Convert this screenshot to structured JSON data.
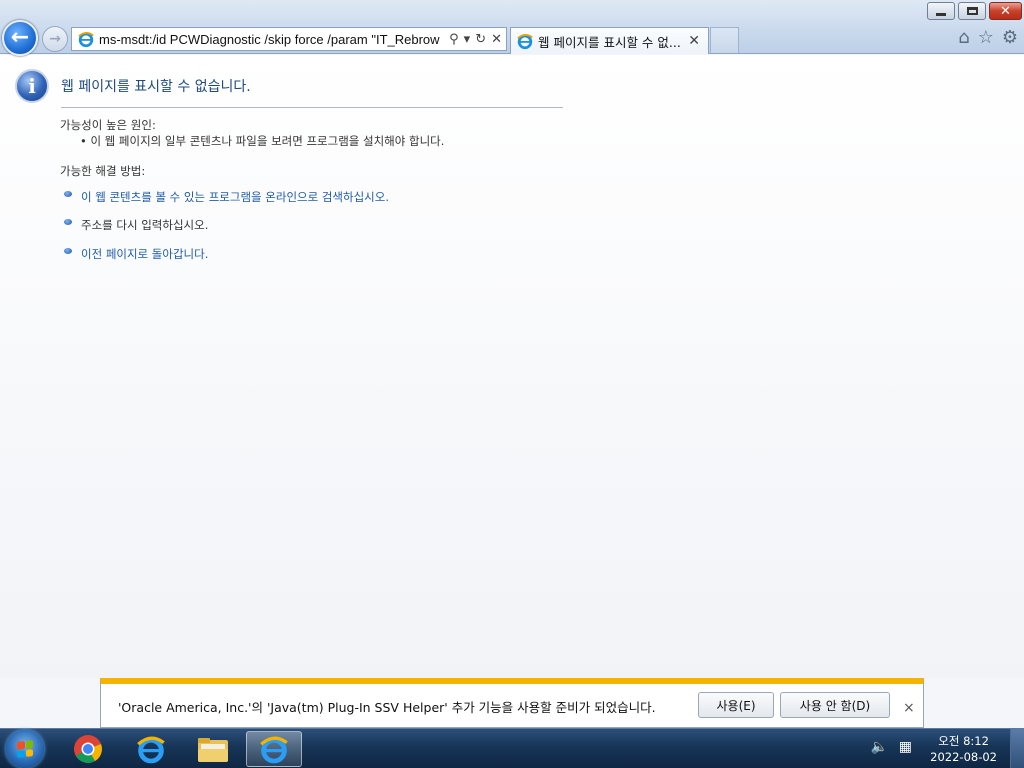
{
  "browser": {
    "address_url": "ms-msdt:/id PCWDiagnostic /skip force /param \"IT_RebrowseFor",
    "tab_title": "웹 페이지를 표시할 수 없...",
    "tab_close": "✕",
    "icons": {
      "back": "←",
      "forward": "→",
      "search": "⚲",
      "dropdown": "▾",
      "refresh": "↻",
      "stop": "✕",
      "home": "⌂",
      "favorites": "☆",
      "tools": "⚙"
    }
  },
  "page": {
    "title": "웹 페이지를 표시할 수 없습니다.",
    "cause_label": "가능성이 높은 원인:",
    "cause_item": "• 이 웹 페이지의 일부 콘텐츠나 파일을 보려면 프로그램을 설치해야 합니다.",
    "solution_label": "가능한 해결 방법:",
    "solutions": [
      "이 웹 콘텐츠를 볼 수 있는 프로그램을 온라인으로 검색하십시오.",
      "주소를 다시 입력하십시오.",
      "이전 페이지로 돌아갑니다."
    ]
  },
  "notification": {
    "message": "'Oracle America, Inc.'의 'Java(tm) Plug-In SSV Helper' 추가 기능을 사용할 준비가 되었습니다.",
    "enable_label": "사용(E)",
    "disable_label": "사용 안 함(D)",
    "close": "×"
  },
  "taskbar": {
    "clock_time": "오전 8:12",
    "clock_date": "2022-08-02",
    "tray_icons": [
      "speaker-icon",
      "network-icon"
    ]
  },
  "colors": {
    "link": "#1e5ca8",
    "notify_accent": "#f5b400",
    "title": "#1f4a80"
  }
}
